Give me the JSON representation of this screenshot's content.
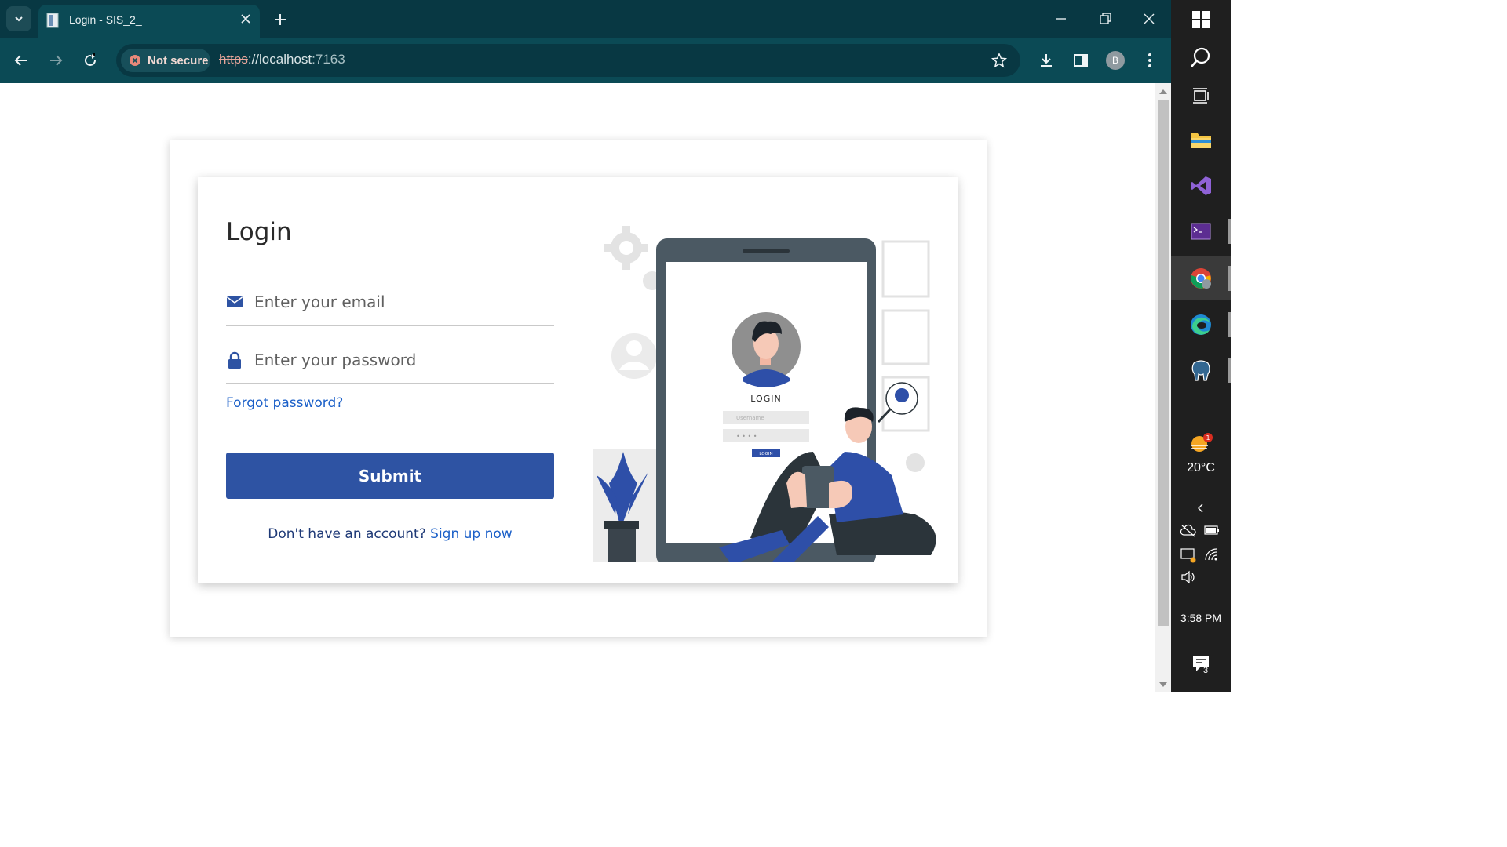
{
  "browser": {
    "tab_title": "Login - SIS_2_",
    "security_label": "Not secure",
    "url_scheme": "https",
    "url_separator": "://",
    "url_host": "localhost",
    "url_port": ":7163",
    "profile_initial": "B"
  },
  "login": {
    "title": "Login",
    "email_placeholder": "Enter your email",
    "password_placeholder": "Enter your password",
    "forgot_password": "Forgot password?",
    "submit_label": "Submit",
    "signup_prompt": "Don't have an account?",
    "signup_link": "Sign up now"
  },
  "illustration": {
    "screen_title": "LOGIN",
    "username_placeholder": "Username",
    "password_dots": "• • • •",
    "button_label": "LOGIN"
  },
  "taskbar": {
    "temperature": "20°C",
    "weather_badge": "1",
    "time": "3:58 PM",
    "notification_count": "3"
  },
  "colors": {
    "chrome_dark": "#083843",
    "chrome": "#0b4a55",
    "primary_button": "#2e53a3",
    "link": "#1a5fc8",
    "illustration_blue": "#2e4fa8",
    "device_gray": "#4b5963"
  }
}
